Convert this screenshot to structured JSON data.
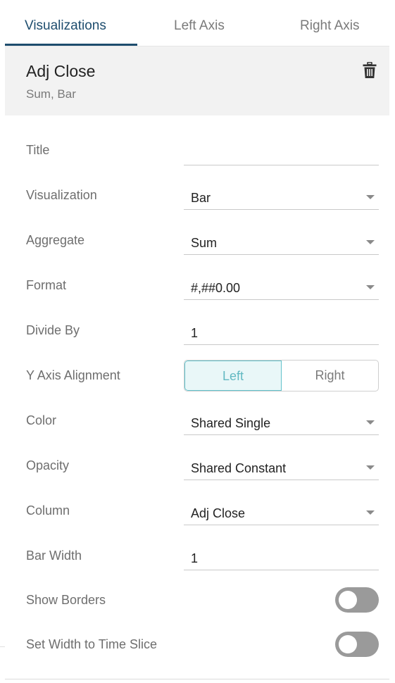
{
  "tabs": [
    {
      "label": "Visualizations",
      "active": true
    },
    {
      "label": "Left Axis",
      "active": false
    },
    {
      "label": "Right Axis",
      "active": false
    }
  ],
  "header": {
    "title": "Adj Close",
    "subtitle": "Sum, Bar",
    "delete_icon": "trash-icon"
  },
  "fields": {
    "title": {
      "label": "Title",
      "value": ""
    },
    "visualization": {
      "label": "Visualization",
      "value": "Bar"
    },
    "aggregate": {
      "label": "Aggregate",
      "value": "Sum"
    },
    "format": {
      "label": "Format",
      "value": "#,##0.00"
    },
    "divide_by": {
      "label": "Divide By",
      "value": "1"
    },
    "y_axis_alignment": {
      "label": "Y Axis Alignment",
      "options": [
        "Left",
        "Right"
      ],
      "selected": "Left"
    },
    "color": {
      "label": "Color",
      "value": "Shared Single"
    },
    "opacity": {
      "label": "Opacity",
      "value": "Shared Constant"
    },
    "column": {
      "label": "Column",
      "value": "Adj Close"
    },
    "bar_width": {
      "label": "Bar Width",
      "value": "1"
    },
    "show_borders": {
      "label": "Show Borders",
      "on": false
    },
    "set_width_to_time_slice": {
      "label": "Set Width to Time Slice",
      "on": false
    }
  },
  "colors": {
    "active_tab": "#1e4d6e",
    "selected_segment": "#62c2cb",
    "toggle_off": "#9a9a9a"
  }
}
